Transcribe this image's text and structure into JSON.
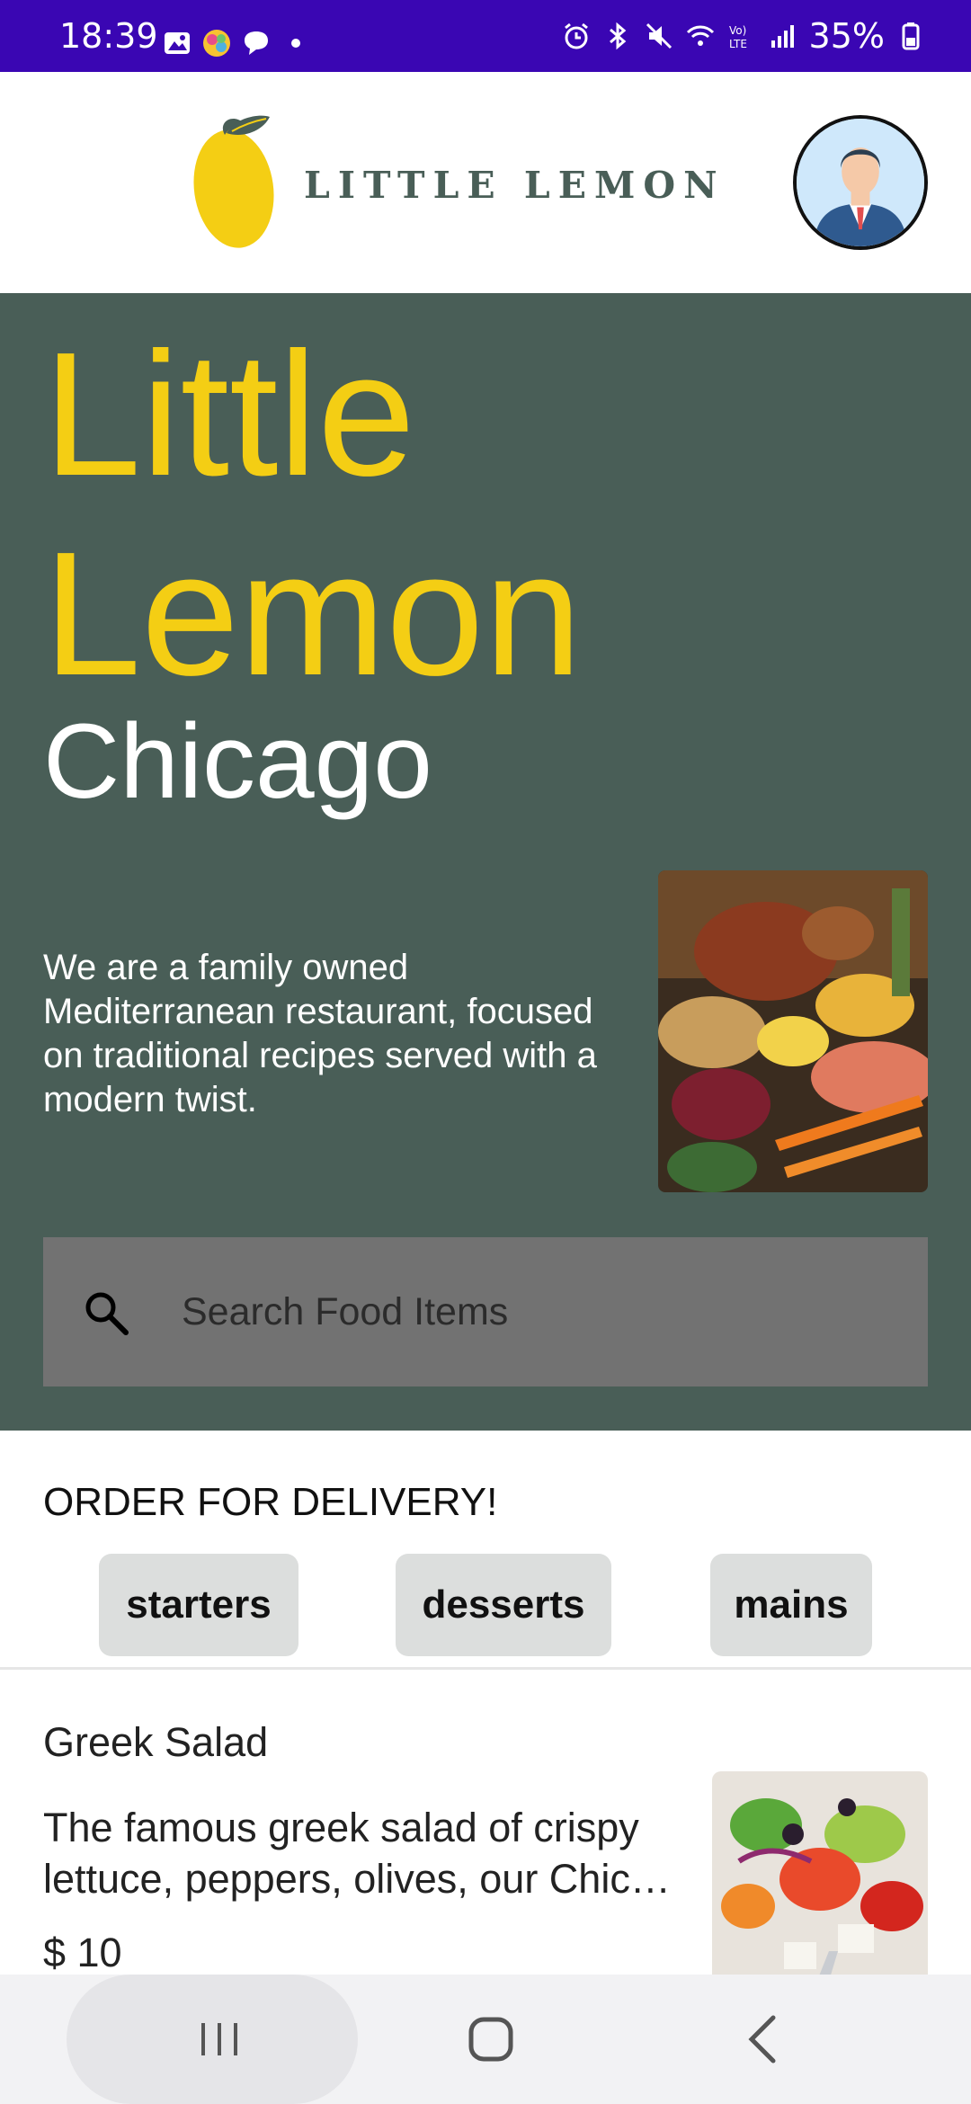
{
  "status_bar": {
    "time": "18:39",
    "battery": "35%",
    "network": "Vo) LTE"
  },
  "header": {
    "logo_text": "LITTLE LEMON",
    "avatar_icon": "profile-avatar-icon"
  },
  "hero": {
    "title_line1": "Little",
    "title_line2": "Lemon",
    "city": "Chicago",
    "description": "We are a family owned Mediterranean restaurant, focused on traditional recipes served with a modern twist.",
    "image_icon": "food-ingredients-image"
  },
  "search": {
    "placeholder": "Search Food Items",
    "value": ""
  },
  "order": {
    "title": "ORDER FOR DELIVERY!",
    "categories": [
      "starters",
      "desserts",
      "mains"
    ]
  },
  "menu_items": [
    {
      "name": "Greek Salad",
      "description": "The famous greek salad of crispy lettuce, peppers, olives, our Chic…",
      "price": "$ 10",
      "image_icon": "greek-salad-image"
    }
  ],
  "colors": {
    "status_bar": "#3a06b3",
    "primary_green": "#495e57",
    "primary_yellow": "#f4ce14",
    "search_bg": "#727272",
    "chip_bg": "#dcdedd"
  }
}
